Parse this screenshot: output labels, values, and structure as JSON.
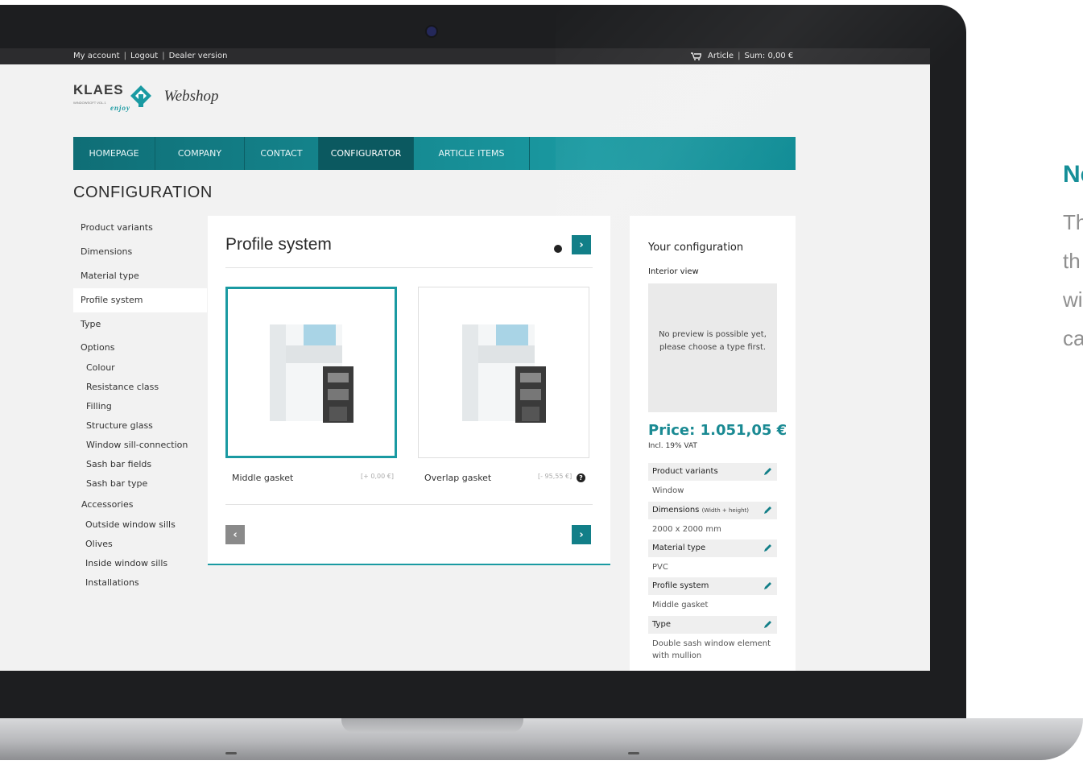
{
  "topbar": {
    "links": [
      "My account",
      "Logout",
      "Dealer version"
    ],
    "cart_article": "Article",
    "cart_sum": "Sum: 0,00 €"
  },
  "brand": {
    "logo_text": "KLAES",
    "logo_small": "WINDOWSOFT VOL.1",
    "logo_tagline": "enjoy",
    "shop_name": "Webshop"
  },
  "nav": {
    "items": [
      "HOMEPAGE",
      "COMPANY",
      "CONTACT",
      "CONFIGURATOR",
      "ARTICLE ITEMS"
    ],
    "active": "CONFIGURATOR"
  },
  "page_title": "CONFIGURATION",
  "sidenav": {
    "items": [
      "Product variants",
      "Dimensions",
      "Material type",
      "Profile system",
      "Type",
      "Options"
    ],
    "options_sub": [
      "Colour",
      "Resistance class",
      "Filling",
      "Structure glass",
      "Window sill-connection",
      "Sash bar fields",
      "Sash bar type"
    ],
    "accessories_label": "Accessories",
    "accessories_sub": [
      "Outside window sills",
      "Olives",
      "Inside window sills",
      "Installations"
    ],
    "active": "Profile system"
  },
  "main": {
    "title": "Profile system",
    "options": [
      {
        "label": "Middle gasket",
        "price": "[+ 0,00 €]",
        "selected": true
      },
      {
        "label": "Overlap gasket",
        "price": "[- 95,55 €]",
        "selected": false
      }
    ]
  },
  "summary": {
    "title": "Your configuration",
    "view_label": "Interior view",
    "preview_text": "No preview is possible yet, please choose a type first.",
    "price": "Price: 1.051,05 €",
    "vat": "Incl. 19% VAT",
    "items": [
      {
        "label": "Product variants",
        "note": "",
        "value": "Window"
      },
      {
        "label": "Dimensions",
        "note": "(Width + height)",
        "value": "2000 x 2000 mm"
      },
      {
        "label": "Material type",
        "note": "",
        "value": "PVC"
      },
      {
        "label": "Profile system",
        "note": "",
        "value": "Middle gasket"
      },
      {
        "label": "Type",
        "note": "",
        "value": "Double sash window element with mullion"
      }
    ]
  },
  "side_text": {
    "title": "Ne",
    "lines": [
      "Th",
      "th",
      "wi",
      "ca"
    ]
  },
  "colors": {
    "accent": "#1a9aa2",
    "nav_dark": "#0b5960",
    "bezel": "#1d1e20"
  },
  "icons": [
    "cart-icon",
    "house-logo-icon",
    "info-icon",
    "chevron-right-icon",
    "chevron-left-icon",
    "help-icon",
    "pencil-icon",
    "camera-icon"
  ]
}
